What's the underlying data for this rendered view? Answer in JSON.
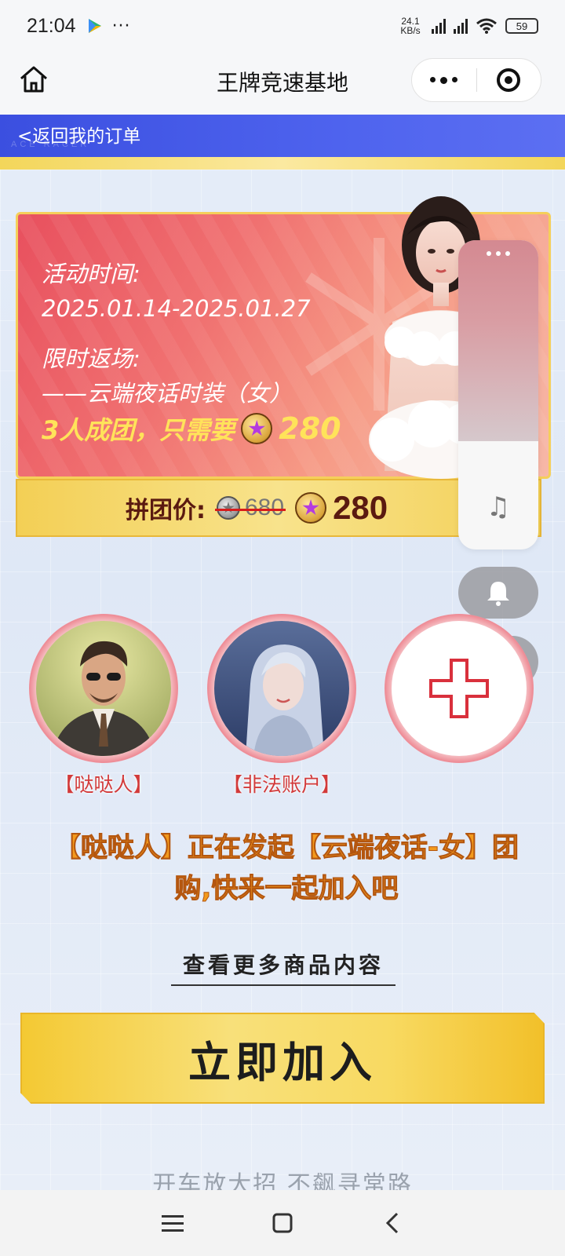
{
  "status_bar": {
    "time": "21:04",
    "network_speed": "24.1 KB/s",
    "battery": "59",
    "icons": [
      "play-store-icon",
      "more-dots-icon",
      "signal-icon",
      "wifi-icon",
      "battery-icon"
    ]
  },
  "title_bar": {
    "title": "王牌竞速基地",
    "icons": [
      "home-icon",
      "more-icon",
      "close-target-icon"
    ]
  },
  "back_bar": {
    "label": "<返回我的订单",
    "watermark": "ACE RACER"
  },
  "banner": {
    "time_label": "活动时间:",
    "time_range": "2025.01.14-2025.01.27",
    "return_label": "限时返场:",
    "item_name": "——云端夜话时装（女）",
    "deal_prefix": "3人成团，只需要",
    "deal_price": "280"
  },
  "price_bar": {
    "label": "拼团价:",
    "old_price": "680",
    "new_price": "280"
  },
  "floating_widget": {
    "icons": [
      "more-dots-icon",
      "music-icon",
      "bell-icon",
      "moon-icon"
    ]
  },
  "members": [
    {
      "name": "【哒哒人】"
    },
    {
      "name": "【非法账户】"
    }
  ],
  "invite": {
    "line1": "【哒哒人】正在发起【云端夜话-女】团",
    "line2": "购,快来一起加入吧"
  },
  "more_link": "查看更多商品内容",
  "join_button": "立即加入",
  "slogan": "开车放大招 不飙寻常路",
  "colors": {
    "accent_blue": "#3b4fe0",
    "gold": "#f4c933",
    "banner_red": "#e8505e",
    "member_name": "#d23a3a",
    "invite_orange": "#f39a1c"
  }
}
